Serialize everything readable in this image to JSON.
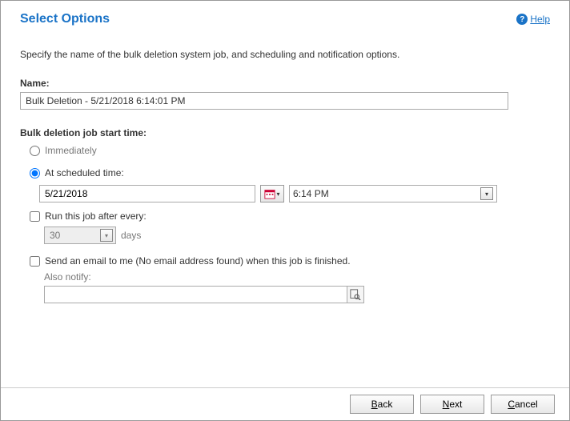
{
  "header": {
    "title": "Select Options",
    "help_label": "Help"
  },
  "description": "Specify the name of the bulk deletion system job, and scheduling and notification options.",
  "name_section": {
    "label": "Name:",
    "value": "Bulk Deletion - 5/21/2018 6:14:01 PM"
  },
  "schedule": {
    "heading": "Bulk deletion job start time:",
    "immediately_label": "Immediately",
    "scheduled_label": "At scheduled time:",
    "selected": "scheduled",
    "date_value": "5/21/2018",
    "time_value": "6:14 PM",
    "repeat_label": "Run this job after every:",
    "repeat_checked": false,
    "repeat_value": "30",
    "repeat_unit": "days"
  },
  "email": {
    "checkbox_label": "Send an email to me (No email address found) when this job is finished.",
    "checked": false,
    "also_notify_label": "Also notify:",
    "notify_value": ""
  },
  "footer": {
    "back": "Back",
    "next": "Next",
    "cancel": "Cancel"
  }
}
